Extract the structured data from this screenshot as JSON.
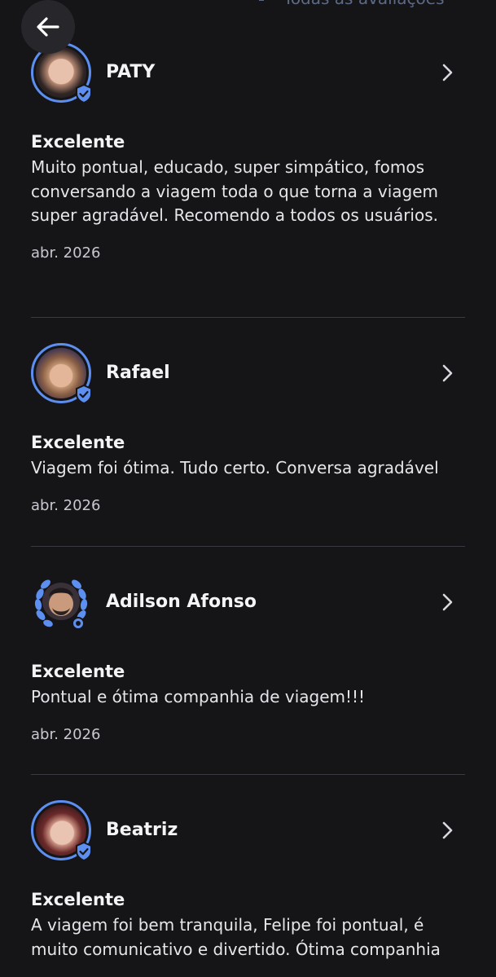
{
  "header": {
    "top_link_label": "Todas as avaliações",
    "back_icon": "arrow-left-icon"
  },
  "reviews": [
    {
      "name": "PATY",
      "rating": "Excelente",
      "comment": "Muito pontual, educado, super simpático, fomos conversando a viagem toda o que torna a viagem super agradável. Recomendo a todos os usuários.",
      "date": "abr. 2026",
      "badge": "verified-icon"
    },
    {
      "name": "Rafael",
      "rating": "Excelente",
      "comment": "Viagem foi ótima. Tudo certo. Conversa agradável",
      "date": "abr. 2026",
      "badge": "verified-icon"
    },
    {
      "name": "Adilson Afonso",
      "rating": "Excelente",
      "comment": "Pontual e ótima companhia de viagem!!!",
      "date": "abr. 2026",
      "badge": "laurel-medal-icon"
    },
    {
      "name": "Beatriz",
      "rating": "Excelente",
      "comment": "A viagem foi bem tranquila, Felipe foi pontual, é muito comunicativo e divertido. Ótima companhia",
      "date": "",
      "badge": "verified-icon"
    }
  ],
  "colors": {
    "background": "#151518",
    "accent": "#5d8ff0",
    "divider": "#3a3a40",
    "text": "#f4f4f6"
  }
}
